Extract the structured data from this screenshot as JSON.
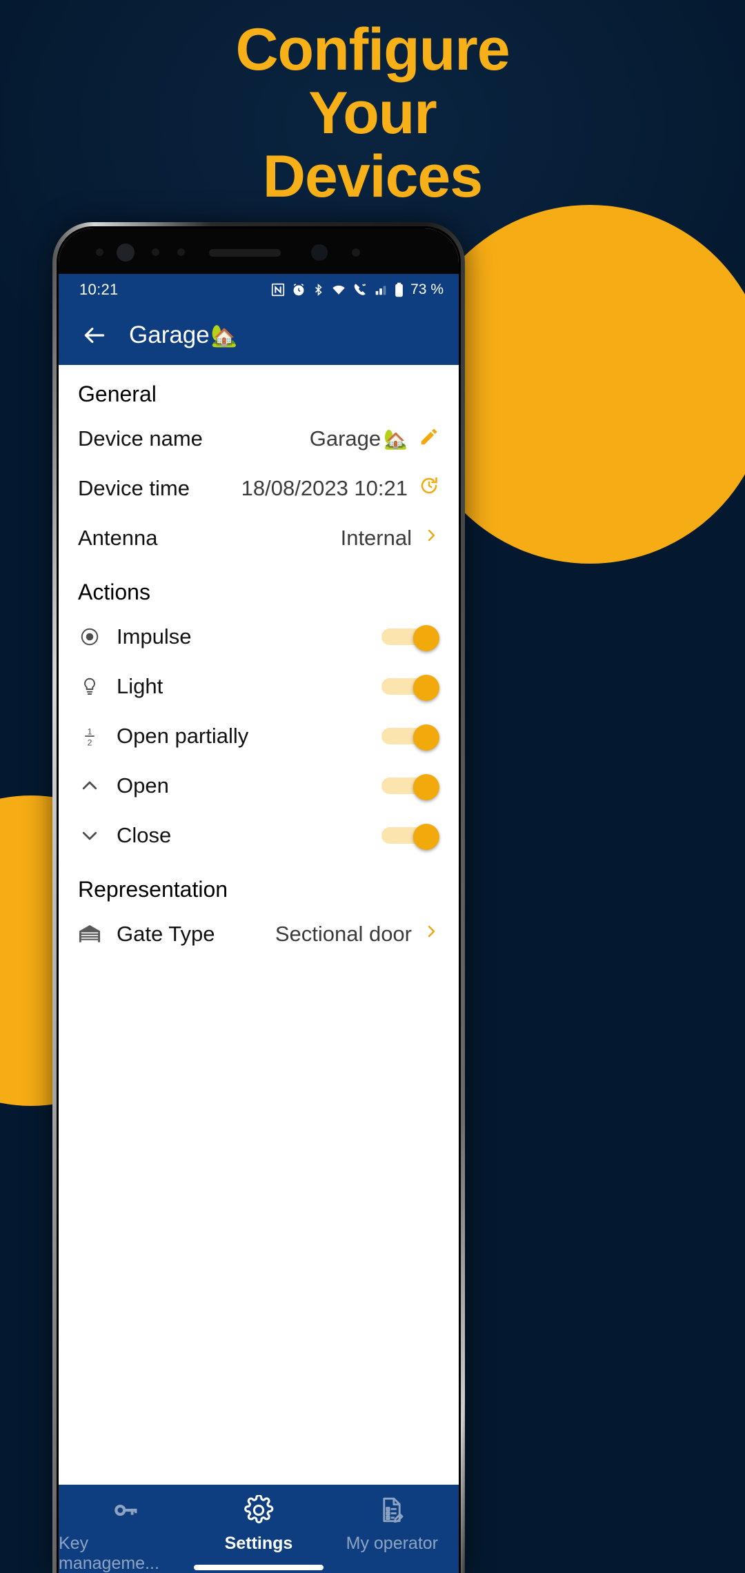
{
  "promo": {
    "headline_lines": [
      "Configure",
      "Your",
      "Devices"
    ],
    "accent_color": "#f6ac15",
    "background_color": "#04192f"
  },
  "status_bar": {
    "time": "10:21",
    "battery_percent": "73 %",
    "icons": [
      "nfc-icon",
      "alarm-icon",
      "bluetooth-icon",
      "wifi-icon",
      "call-icon",
      "signal-icon",
      "battery-icon"
    ]
  },
  "app_bar": {
    "back_icon": "arrow-left-icon",
    "title": "Garage",
    "title_emoji": "🏡"
  },
  "sections": {
    "general": {
      "header": "General",
      "rows": [
        {
          "label": "Device name",
          "value": "Garage",
          "value_emoji": "🏡",
          "trailing_icon": "pencil-edit-icon"
        },
        {
          "label": "Device time",
          "value": "18/08/2023 10:21",
          "trailing_icon": "refresh-clock-icon"
        },
        {
          "label": "Antenna",
          "value": "Internal",
          "trailing_icon": "chevron-right-icon"
        }
      ]
    },
    "actions": {
      "header": "Actions",
      "rows": [
        {
          "icon": "impulse-radio-icon",
          "label": "Impulse",
          "enabled": true
        },
        {
          "icon": "lightbulb-icon",
          "label": "Light",
          "enabled": true
        },
        {
          "icon": "half-fraction-icon",
          "label": "Open partially",
          "enabled": true
        },
        {
          "icon": "chevron-up-icon",
          "label": "Open",
          "enabled": true
        },
        {
          "icon": "chevron-down-icon",
          "label": "Close",
          "enabled": true
        }
      ]
    },
    "representation": {
      "header": "Representation",
      "rows": [
        {
          "icon": "garage-door-icon",
          "label": "Gate Type",
          "value": "Sectional door",
          "trailing_icon": "chevron-right-icon"
        }
      ]
    }
  },
  "bottom_nav": {
    "items": [
      {
        "icon": "key-icon",
        "label": "Key manageme...",
        "active": false
      },
      {
        "icon": "gear-icon",
        "label": "Settings",
        "active": true
      },
      {
        "icon": "document-edit-icon",
        "label": "My operator",
        "active": false
      }
    ]
  }
}
